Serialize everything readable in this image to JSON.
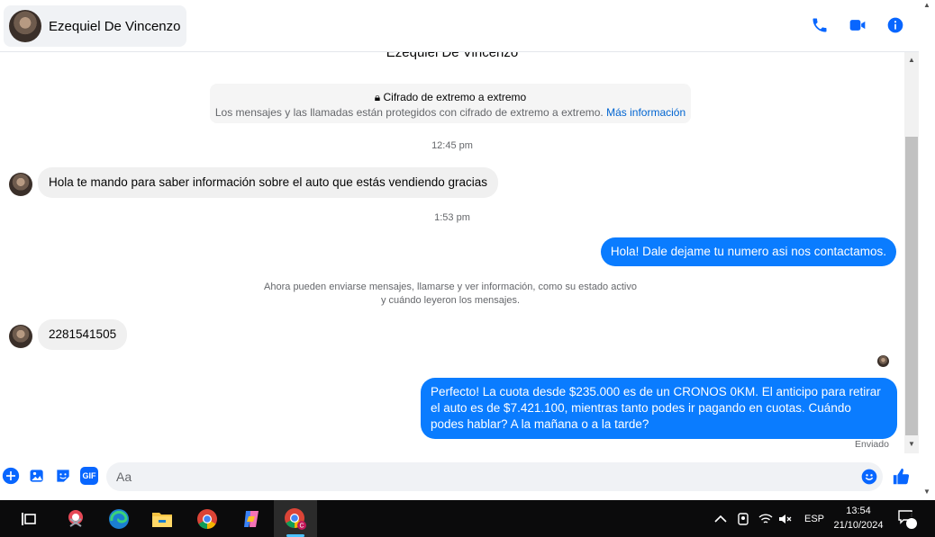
{
  "header": {
    "contact_name": "Ezequiel De Vincenzo",
    "icons": [
      "phone-icon",
      "video-icon",
      "info-icon"
    ]
  },
  "chat": {
    "top_name": "Ezequiel De Vincenzo",
    "e2e_title": "Cifrado de extremo a extremo",
    "e2e_body": "Los mensajes y las llamadas están protegidos con cifrado de extremo a extremo.",
    "e2e_link": "Más información",
    "timestamp_1": "12:45 pm",
    "msg_in_1": "Hola te mando para saber información sobre el auto que estás vendiendo gracias",
    "timestamp_2": "1:53 pm",
    "msg_out_1": "Hola! Dale dejame tu numero  asi nos contactamos.",
    "system_line_1": "Ahora pueden enviarse mensajes, llamarse y ver información, como su estado activo",
    "system_line_2": "y cuándo leyeron los mensajes.",
    "msg_in_2": "2281541505",
    "msg_out_2": "Perfecto! La cuota desde $235.000 es de un CRONOS 0KM. El anticipo para retirar el auto es de $7.421.100, mientras tanto podes ir pagando en cuotas. Cuándo podes hablar? A la mañana o a la tarde?",
    "status": "Enviado"
  },
  "composer": {
    "placeholder": "Aa",
    "icons": [
      "plus-icon",
      "image-icon",
      "sticker-icon",
      "gif-icon",
      "emoji-icon",
      "like-icon"
    ],
    "gif_label": "GIF"
  },
  "taskbar": {
    "language": "ESP",
    "time": "13:54",
    "date": "21/10/2024",
    "notification_count": "1"
  },
  "colors": {
    "accent": "#0a7cff",
    "icon_blue": "#0866ff",
    "incoming_bubble": "#f0f0f0"
  }
}
